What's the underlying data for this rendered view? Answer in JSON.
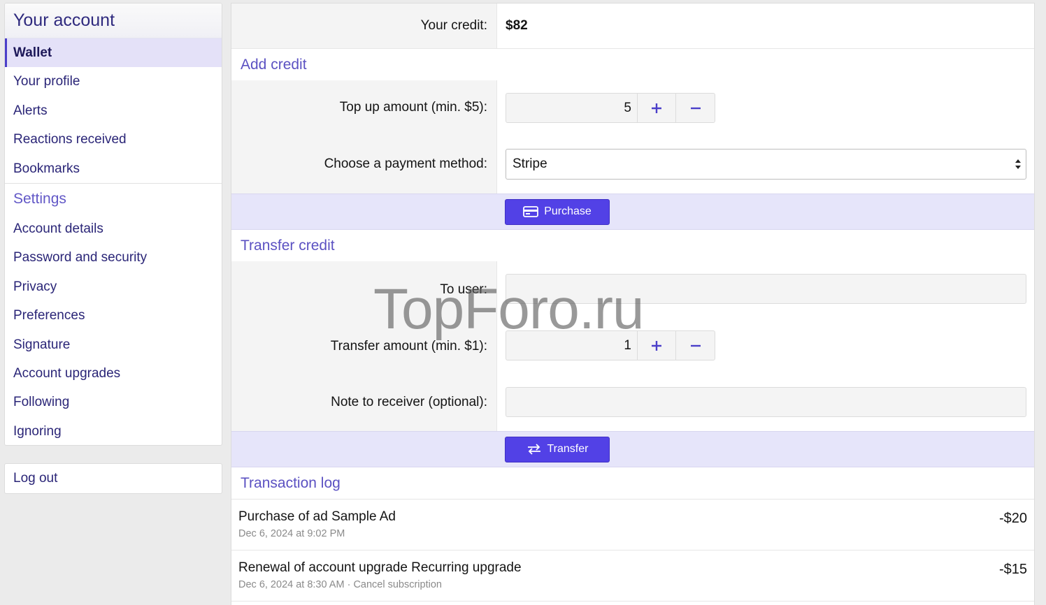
{
  "sidebar": {
    "title": "Your account",
    "items": [
      {
        "label": "Wallet"
      },
      {
        "label": "Your profile"
      },
      {
        "label": "Alerts"
      },
      {
        "label": "Reactions received"
      },
      {
        "label": "Bookmarks"
      }
    ],
    "settings_title": "Settings",
    "settings_items": [
      {
        "label": "Account details"
      },
      {
        "label": "Password and security"
      },
      {
        "label": "Privacy"
      },
      {
        "label": "Preferences"
      },
      {
        "label": "Signature"
      },
      {
        "label": "Account upgrades"
      },
      {
        "label": "Following"
      },
      {
        "label": "Ignoring"
      }
    ],
    "logout": "Log out"
  },
  "credit": {
    "label": "Your credit:",
    "value": "$82"
  },
  "add_credit": {
    "title": "Add credit",
    "topup_label": "Top up amount (min. $5):",
    "topup_value": "5",
    "plus": "+",
    "minus": "−",
    "method_label": "Choose a payment method:",
    "method_value": "Stripe",
    "purchase_label": "Purchase"
  },
  "transfer": {
    "title": "Transfer credit",
    "to_user_label": "To user:",
    "amount_label": "Transfer amount (min. $1):",
    "amount_value": "1",
    "note_label": "Note to receiver (optional):",
    "transfer_label": "Transfer"
  },
  "log": {
    "title": "Transaction log",
    "entries": [
      {
        "title": "Purchase of ad Sample Ad",
        "date": "Dec 6, 2024 at 9:02 PM",
        "amount": "-$20",
        "extra": ""
      },
      {
        "title": "Renewal of account upgrade Recurring upgrade",
        "date": "Dec 6, 2024 at 8:30 AM",
        "amount": "-$15",
        "extra": "Cancel subscription"
      }
    ]
  },
  "watermark": "TopForo.ru",
  "colors": {
    "accent": "#5241e6",
    "link": "#2a2577",
    "section": "#5b51c2",
    "active_bg": "#e4e1f8"
  }
}
